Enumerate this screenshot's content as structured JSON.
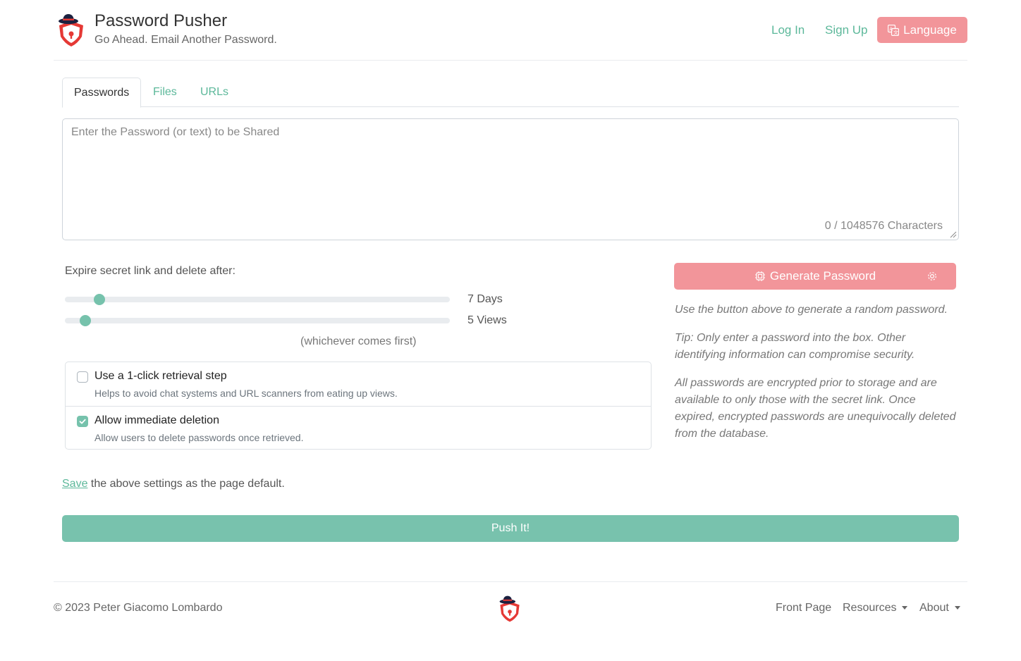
{
  "header": {
    "brand_title": "Password Pusher",
    "brand_tagline": "Go Ahead. Email Another Password.",
    "login_label": "Log In",
    "signup_label": "Sign Up",
    "language_label": "Language"
  },
  "tabs": [
    {
      "label": "Passwords",
      "active": true
    },
    {
      "label": "Files",
      "active": false
    },
    {
      "label": "URLs",
      "active": false
    }
  ],
  "password_box": {
    "placeholder": "Enter the Password (or text) to be Shared",
    "value": "",
    "char_count": "0 / 1048576 Characters"
  },
  "expiration": {
    "label": "Expire secret link and delete after:",
    "days_value": "7 Days",
    "days_fraction": 0.077,
    "views_value": "5 Views",
    "views_fraction": 0.04,
    "whichever": "(whichever comes first)"
  },
  "options": [
    {
      "title": "Use a 1-click retrieval step",
      "help": "Helps to avoid chat systems and URL scanners from eating up views.",
      "checked": false
    },
    {
      "title": "Allow immediate deletion",
      "help": "Allow users to delete passwords once retrieved.",
      "checked": true
    }
  ],
  "generator": {
    "button_label": "Generate Password",
    "note1": "Use the button above to generate a random password.",
    "note2": "Tip: Only enter a password into the box. Other identifying information can compromise security.",
    "note3": "All passwords are encrypted prior to storage and are available to only those with the secret link. Once expired, encrypted passwords are unequivocally deleted from the database."
  },
  "save": {
    "link_label": "Save",
    "rest": " the above settings as the page default."
  },
  "push_label": "Push It!",
  "footer": {
    "copyright": "© 2023 Peter Giacomo Lombardo",
    "front_page": "Front Page",
    "resources": "Resources",
    "about": "About"
  },
  "colors": {
    "accent_green": "#78c2ad",
    "accent_pink": "#f2959a",
    "link_green": "#5cb89a"
  }
}
